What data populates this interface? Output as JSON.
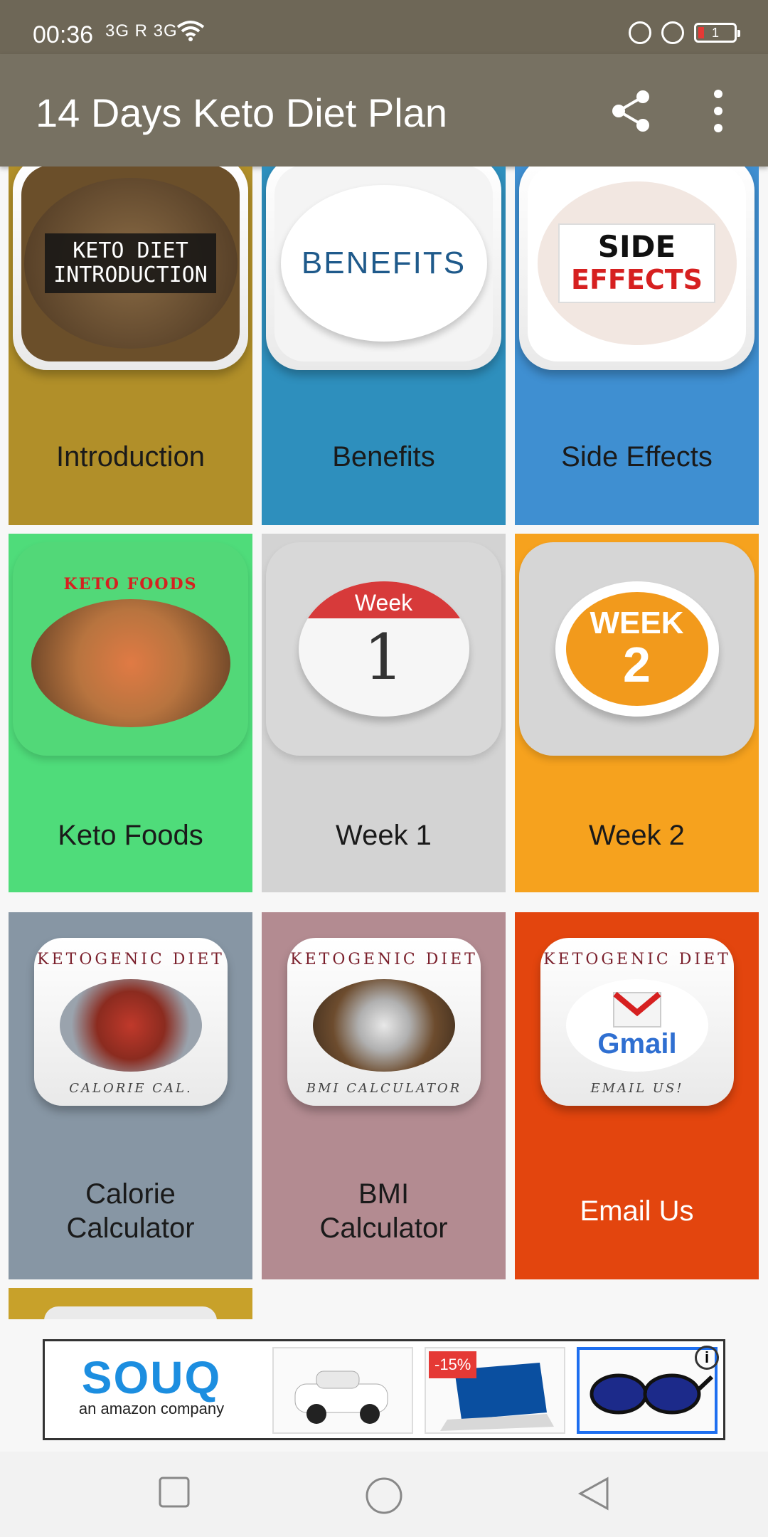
{
  "status_bar": {
    "time": "00:36",
    "signal": "3G  R 3G",
    "battery": "1"
  },
  "app_bar": {
    "title": "14 Days Keto Diet Plan"
  },
  "tiles": [
    {
      "label": "Introduction",
      "icon_text_1": "KETO DIET",
      "icon_text_2": "INTRODUCTION",
      "color": "#b18f29"
    },
    {
      "label": "Benefits",
      "icon_text_1": "BENEFITS",
      "color": "#2e8fbd"
    },
    {
      "label": "Side Effects",
      "icon_text_1": "SIDE",
      "icon_text_2": "EFFECTS",
      "color": "#3f8fd1"
    },
    {
      "label": "Keto Foods",
      "icon_text_1": "KETO FOODS",
      "color": "#4fdc7a"
    },
    {
      "label": "Week 1",
      "icon_text_1": "Week",
      "icon_text_2": "1",
      "color": "#d3d3d3"
    },
    {
      "label": "Week 2",
      "icon_text_1": "WEEK",
      "icon_text_2": "2",
      "color": "#f6a21e"
    },
    {
      "label": "Calorie\nCalculator",
      "label_1": "Calorie",
      "label_2": "Calculator",
      "icon_text_1": "KETOGENIC DIET",
      "icon_text_2": "CALORIE CAL.",
      "color": "#8796a4"
    },
    {
      "label_1": "BMI",
      "label_2": "Calculator",
      "icon_text_1": "KETOGENIC DIET",
      "icon_text_2": "BMI CALCULATOR",
      "color": "#b38b91"
    },
    {
      "label": "Email Us",
      "icon_text_1": "KETOGENIC DIET",
      "icon_text_2": "EMAIL US!",
      "icon_text_3": "Gmail",
      "color": "#e3450e"
    }
  ],
  "ad": {
    "brand": "SOUQ",
    "tagline": "an amazon company",
    "discount": "-15%",
    "info": "i"
  }
}
